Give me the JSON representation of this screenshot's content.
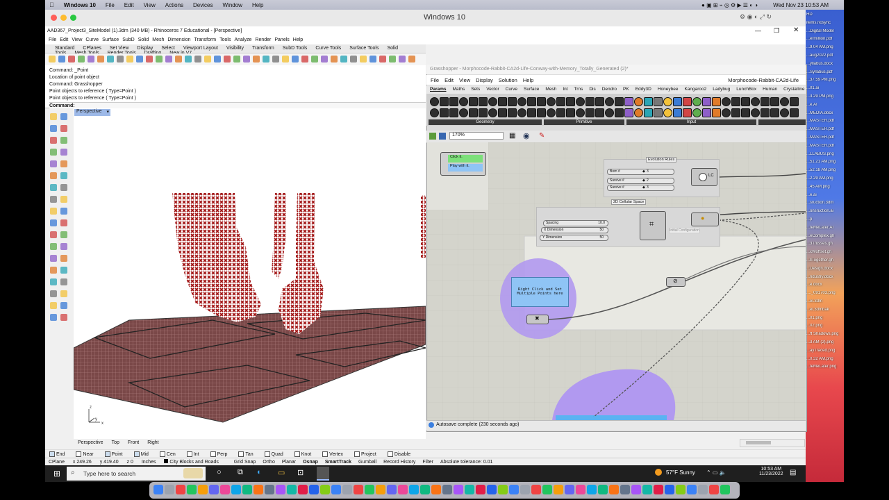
{
  "macbar": {
    "app": "Windows 10",
    "menus": [
      "File",
      "Edit",
      "View",
      "Actions",
      "Devices",
      "Window",
      "Help"
    ],
    "clock": "Wed Nov 23  10:53 AM"
  },
  "vm": {
    "title": "Windows 10"
  },
  "rhino": {
    "title": "AAD367_Project3_SiteModel (1).3dm (340 MB) - Rhinoceros 7 Educational - [Perspective]",
    "menus": [
      "File",
      "Edit",
      "View",
      "Curve",
      "Surface",
      "SubD",
      "Solid",
      "Mesh",
      "Dimension",
      "Transform",
      "Tools",
      "Analyze",
      "Render",
      "Panels",
      "Help"
    ],
    "tabs": [
      "Standard",
      "CPlanes",
      "Set View",
      "Display",
      "Select",
      "Viewport Layout",
      "Visibility",
      "Transform",
      "SubD Tools",
      "Curve Tools",
      "Surface Tools",
      "Solid Tools",
      "Mesh Tools",
      "Render Tools",
      "Drafting",
      "New in V7"
    ],
    "command_history": [
      "Command: _Point",
      "Location of point object",
      "Command: Grasshopper",
      "Point objects to reference ( Type=Point )",
      "Point objects to reference ( Type=Point )"
    ],
    "command_prompt": "Command:",
    "viewport_label": "Perspective",
    "viewport_tabs": [
      "Perspective",
      "Top",
      "Front",
      "Right"
    ],
    "osnaps": [
      "End",
      "Near",
      "Point",
      "Mid",
      "Cen",
      "Int",
      "Perp",
      "Tan",
      "Quad",
      "Knot",
      "Vertex",
      "Project",
      "Disable"
    ],
    "status": {
      "cplane": "CPlane",
      "x": "x 249.26",
      "y": "y 419.40",
      "z": "z 0",
      "units": "Inches",
      "layer": "City Blocks and Roads",
      "items": [
        "Grid Snap",
        "Ortho",
        "Planar",
        "Osnap",
        "SmartTrack",
        "Gumball",
        "Record History",
        "Filter",
        "Absolute tolerance: 0.01"
      ]
    }
  },
  "grasshopper": {
    "title": "Grasshopper - Morphocode-Rabbit-CA2d-Life-Conway-with-Memory_Totally_Generated (2)*",
    "doc_name": "Morphocode-Rabbit-CA2d-Life",
    "menus": [
      "File",
      "Edit",
      "View",
      "Display",
      "Solution",
      "Help"
    ],
    "tabs": [
      "Params",
      "Maths",
      "Sets",
      "Vector",
      "Curve",
      "Surface",
      "Mesh",
      "Int",
      "Trns",
      "Dis",
      "Dendro",
      "PK",
      "Eddy3D",
      "Honeybee",
      "Kangaroo2",
      "Ladybug",
      "LunchBox",
      "Human",
      "Crystalline"
    ],
    "sections": [
      "Geometry",
      "Primitive",
      "Input"
    ],
    "zoom": "170%",
    "autosave": "Autosave complete (230 seconds ago)",
    "panel_note": "Right Click and Set Multiple Points here",
    "button_lines": [
      "Click it.",
      "Play with it."
    ],
    "groups": {
      "rules": "Evolution Rules",
      "space": "2D Cellular Space"
    },
    "sliders": [
      {
        "label": "Born #",
        "value": "3"
      },
      {
        "label": "Survive #",
        "value": "2"
      },
      {
        "label": "Survive #",
        "value": "3"
      },
      {
        "label": "Spacing",
        "value": "10.0"
      },
      {
        "label": "X Dimension",
        "value": "50"
      },
      {
        "label": "Y Dimension",
        "value": "50"
      }
    ],
    "lc_label": "LC",
    "init_config": "Initial Configuration"
  },
  "taskbar": {
    "search": "Type here to search",
    "weather": "57°F  Sunny",
    "time": "10:53 AM",
    "date": "11/23/2022"
  },
  "desktop_files": [
    "HD",
    "items.nosync",
    "...Digital Model",
    "...ermillion.pdf",
    "...9.04 AM.png",
    "...aug2022.pdf",
    "...yllabus.docx",
    "...Syllabus.pdf",
    "...37.59 PM.png",
    "...01.ai",
    "...3.29 PM.png",
    "...e.AI",
    "...MEDIA.docx",
    "...MASTER.pdf",
    "...MASTER.pdf",
    "...MASTER.pdf",
    "...MASTER.pdf",
    "...LLABUS.png",
    "...51.21 AM.png",
    "...52.18 AM.png",
    "...2.29 AM.png",
    "...45 AM.png",
    "...e.ai",
    "...sruction.3dm",
    "...onsruction.ai",
    "...p",
    "...teMeLater.AI",
    "...eComplex.gh",
    "...3Trusses.gh",
    "...xWoffset.gh",
    "...llTogether.gh",
    "...Design.docx",
    "...ndustry.docx",
    "...e.docx",
    "...._091703.png",
    "...el.3dm",
    "...el.3dmbak",
    "...01.png",
    "...02.png",
    "...ft Shadows.png",
    "...3 AM (2).png",
    "...ayTraced.png",
    "...0.32 AM.png",
    "...teMeLater.png"
  ],
  "colors": {
    "accent": "#9db9e8",
    "voxel": "#a01010",
    "purple": "#a98bf0",
    "panel": "#8fc4f5",
    "button_green": "#7de07a"
  }
}
